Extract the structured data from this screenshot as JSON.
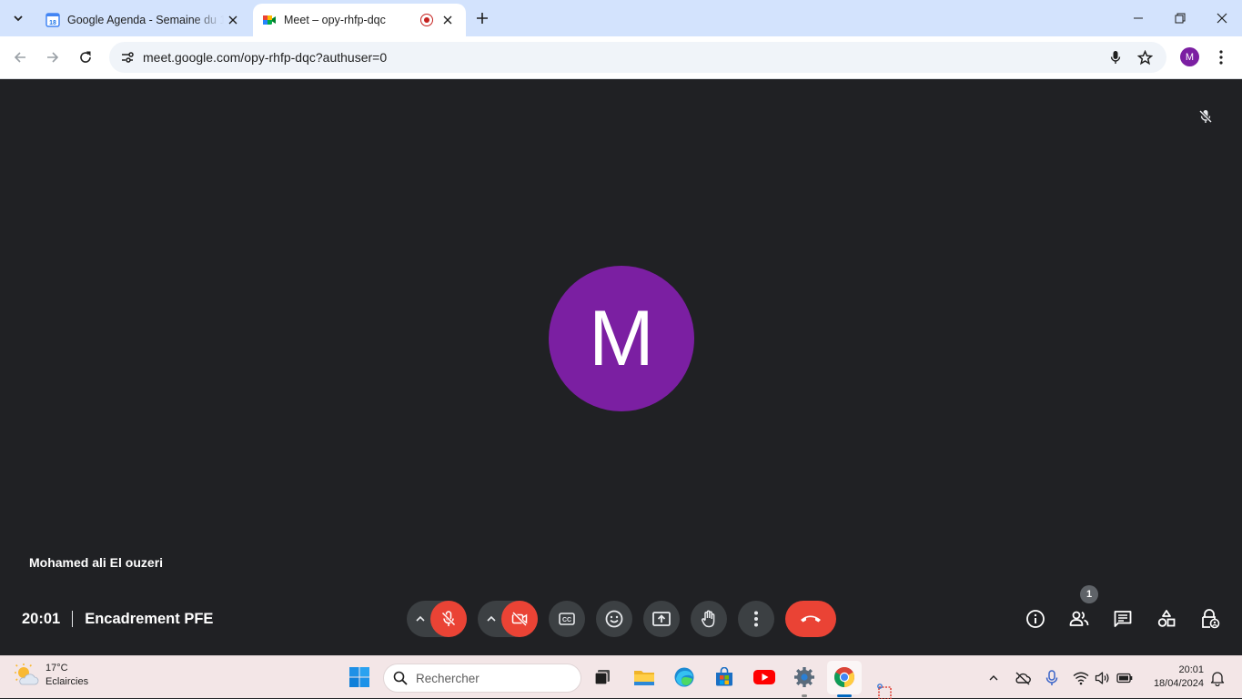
{
  "browser": {
    "tabs": [
      {
        "title": "Google Agenda - Semaine du 1",
        "favicon": "calendar-icon",
        "favicon_text": "18",
        "active": false
      },
      {
        "title": "Meet – opy-rhfp-dqc",
        "favicon": "meet-icon",
        "recording": true,
        "active": true
      }
    ],
    "address_bar": {
      "url": "meet.google.com/opy-rhfp-dqc?authuser=0"
    },
    "profile_initial": "M",
    "accent_color": "#d3e3fd"
  },
  "meet": {
    "background_color": "#202124",
    "participant": {
      "name": "Mohamed ali El ouzeri",
      "initial": "M",
      "avatar_color": "#7b1fa2",
      "muted": true
    },
    "meeting": {
      "time": "20:01",
      "title": "Encadrement PFE"
    },
    "controls": {
      "microphone": "off",
      "camera": "off",
      "buttons": [
        "captions-icon",
        "emoji-icon",
        "present-screen-icon",
        "raise-hand-icon",
        "more-options-icon",
        "end-call-icon"
      ],
      "end_call_color": "#ea4335"
    },
    "side_controls": {
      "people_count": "1",
      "buttons": [
        "info-icon",
        "people-icon",
        "chat-icon",
        "activities-icon",
        "host-controls-icon"
      ]
    }
  },
  "taskbar": {
    "weather": {
      "temperature": "17°C",
      "condition": "Eclaircies"
    },
    "search_placeholder": "Rechercher",
    "apps": [
      "windows-start-icon",
      "task-view-icon",
      "file-explorer-icon",
      "edge-icon",
      "microsoft-store-icon",
      "youtube-icon",
      "settings-icon",
      "chrome-icon",
      "snipping-tool-icon"
    ],
    "clock": {
      "time": "20:01",
      "date": "18/04/2024"
    }
  }
}
